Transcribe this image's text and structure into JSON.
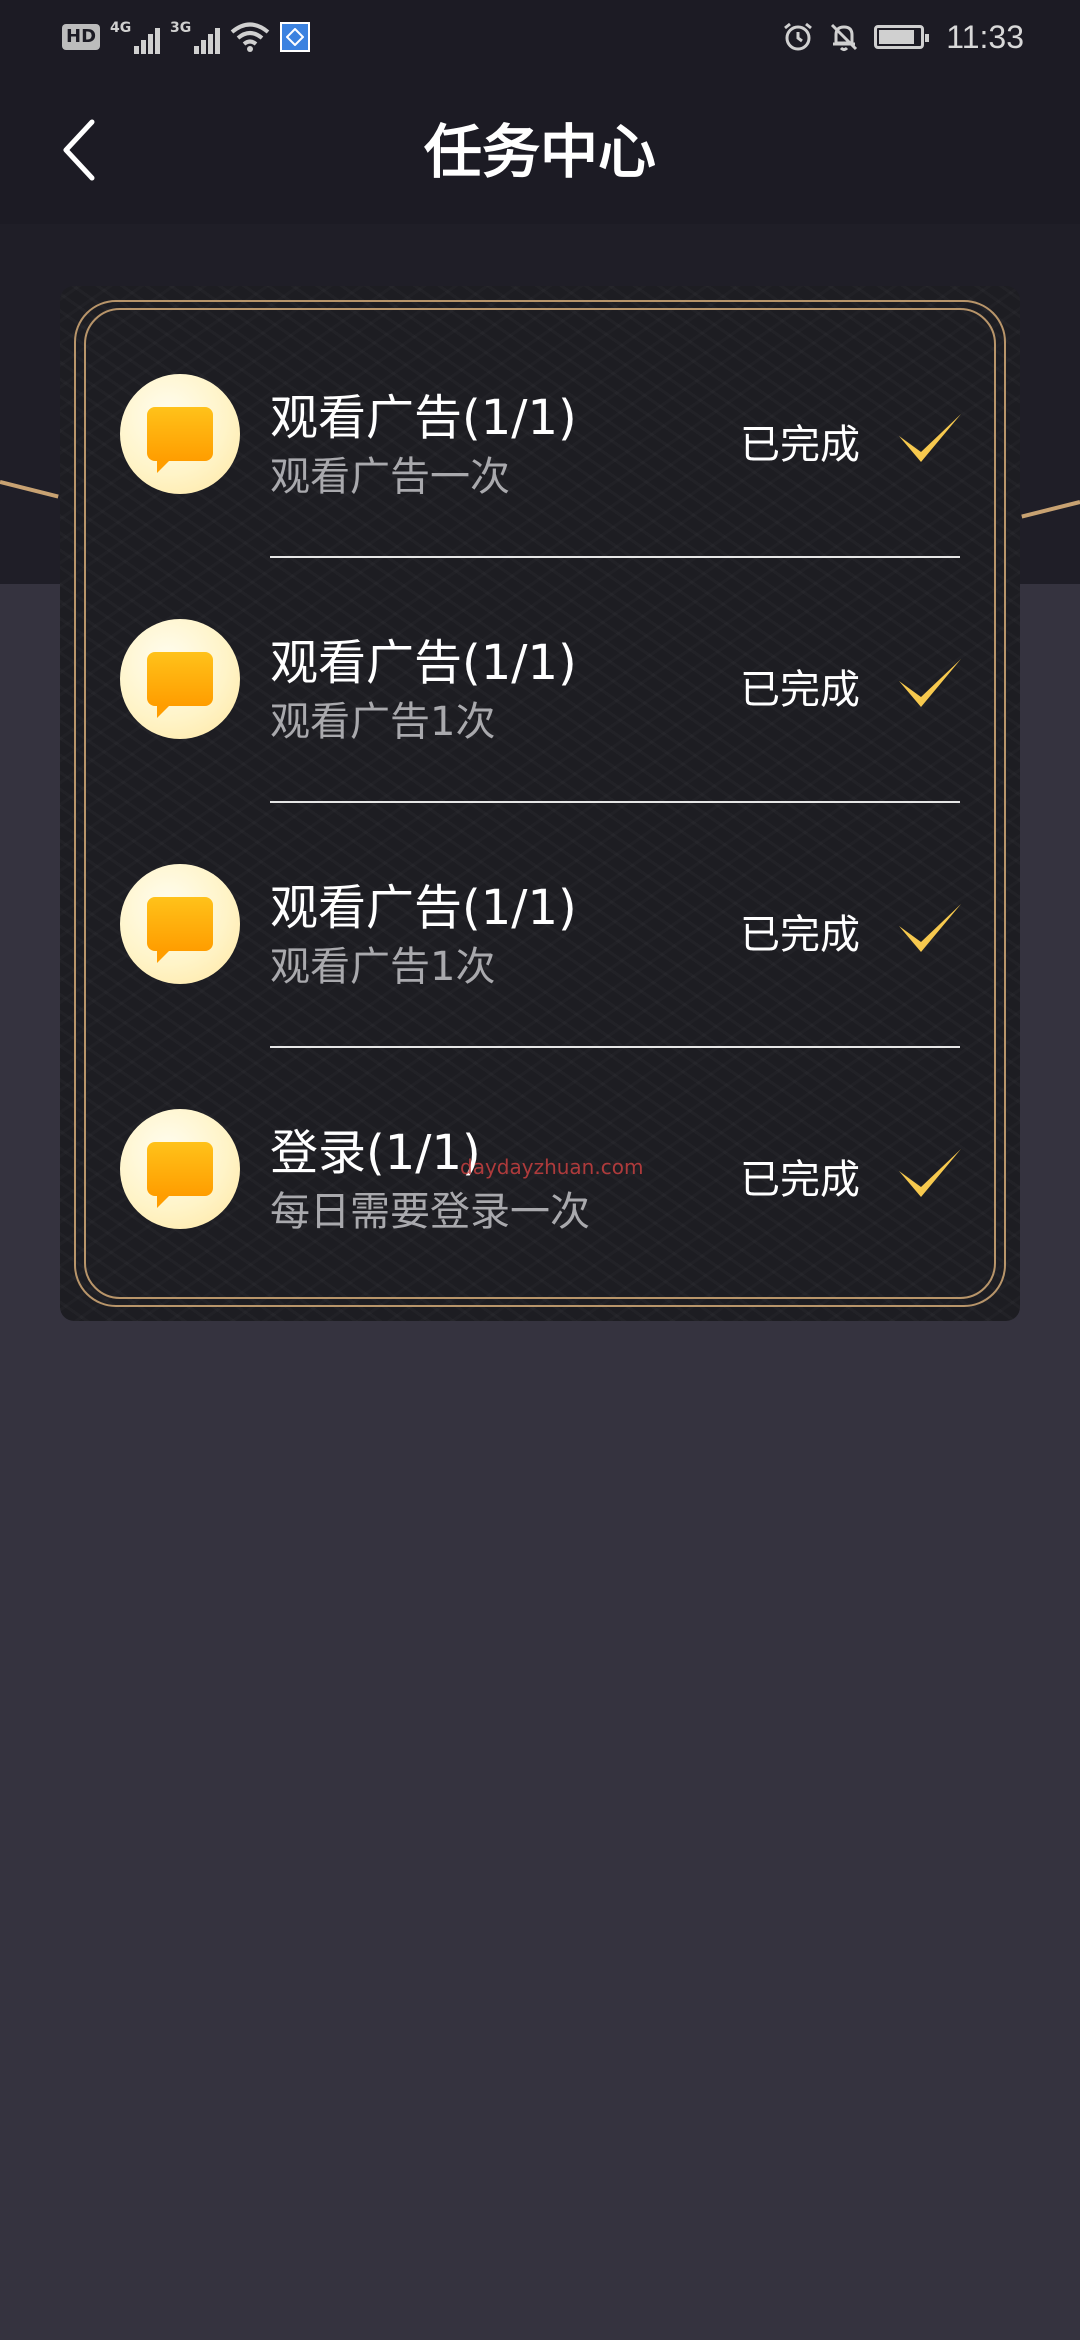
{
  "status_bar": {
    "hd_label": "HD",
    "network_1": "4G",
    "network_2": "3G",
    "time": "11:33",
    "icons": [
      "alarm-icon",
      "bell-off-icon",
      "battery-icon",
      "wifi-icon",
      "location-icon"
    ]
  },
  "header": {
    "title": "任务中心",
    "back_icon": "chevron-left-icon"
  },
  "tasks": [
    {
      "title": "观看广告(1/1)",
      "desc": "观看广告一次",
      "status": "已完成",
      "icon": "chat-bubble-icon"
    },
    {
      "title": "观看广告(1/1)",
      "desc": "观看广告1次",
      "status": "已完成",
      "icon": "chat-bubble-icon"
    },
    {
      "title": "观看广告(1/1)",
      "desc": "观看广告1次",
      "status": "已完成",
      "icon": "chat-bubble-icon"
    },
    {
      "title": "登录(1/1)",
      "desc": "每日需要登录一次",
      "status": "已完成",
      "icon": "chat-bubble-icon"
    }
  ],
  "watermark": "daydayzhuan.com",
  "colors": {
    "background": "#35333f",
    "header": "#1c1b24",
    "card": "#1d1d22",
    "frame_gold": "#b8956a",
    "check_gold": "#f7c94e",
    "bubble_orange": "#ffb00e"
  }
}
